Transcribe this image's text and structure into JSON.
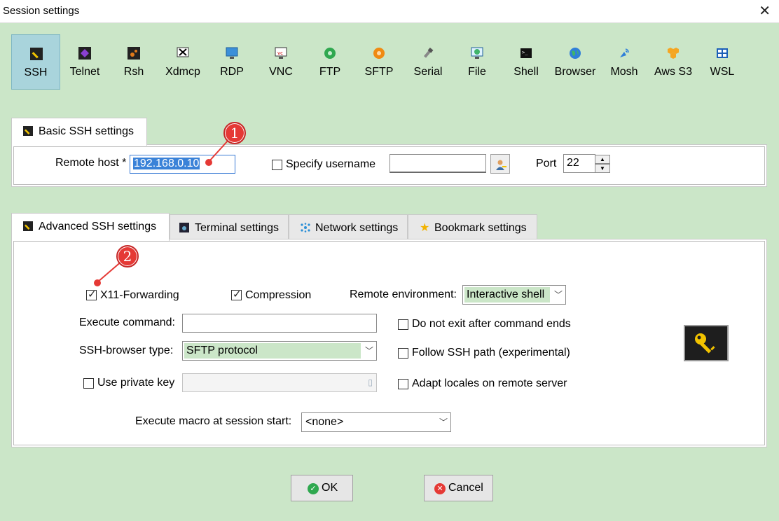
{
  "window": {
    "title": "Session settings"
  },
  "session_types": [
    {
      "label": "SSH",
      "icon": "ssh-icon",
      "selected": true
    },
    {
      "label": "Telnet",
      "icon": "telnet-icon"
    },
    {
      "label": "Rsh",
      "icon": "rsh-icon"
    },
    {
      "label": "Xdmcp",
      "icon": "xdmcp-icon"
    },
    {
      "label": "RDP",
      "icon": "rdp-icon"
    },
    {
      "label": "VNC",
      "icon": "vnc-icon"
    },
    {
      "label": "FTP",
      "icon": "ftp-icon"
    },
    {
      "label": "SFTP",
      "icon": "sftp-icon"
    },
    {
      "label": "Serial",
      "icon": "serial-icon"
    },
    {
      "label": "File",
      "icon": "file-icon"
    },
    {
      "label": "Shell",
      "icon": "shell-icon"
    },
    {
      "label": "Browser",
      "icon": "browser-icon"
    },
    {
      "label": "Mosh",
      "icon": "mosh-icon"
    },
    {
      "label": "Aws S3",
      "icon": "aws-s3-icon"
    },
    {
      "label": "WSL",
      "icon": "wsl-icon"
    }
  ],
  "basic": {
    "tab_label": "Basic SSH settings",
    "remote_host_label": "Remote host *",
    "remote_host_value": "192.168.0.10",
    "specify_username_label": "Specify username",
    "username_value": "",
    "port_label": "Port",
    "port_value": "22"
  },
  "advanced_tabs": [
    {
      "label": "Advanced SSH settings",
      "icon": "ssh-icon",
      "active": true
    },
    {
      "label": "Terminal settings",
      "icon": "terminal-icon"
    },
    {
      "label": "Network settings",
      "icon": "network-icon"
    },
    {
      "label": "Bookmark settings",
      "icon": "star-icon"
    }
  ],
  "advanced": {
    "x11_forwarding_label": "X11-Forwarding",
    "x11_forwarding_checked": true,
    "compression_label": "Compression",
    "compression_checked": true,
    "remote_env_label": "Remote environment:",
    "remote_env_value": "Interactive shell",
    "execute_command_label": "Execute command:",
    "execute_command_value": "",
    "do_not_exit_label": "Do not exit after command ends",
    "ssh_browser_type_label": "SSH-browser type:",
    "ssh_browser_type_value": "SFTP protocol",
    "follow_ssh_path_label": "Follow SSH path (experimental)",
    "use_private_key_label": "Use private key",
    "adapt_locales_label": "Adapt locales on remote server",
    "macro_label": "Execute macro at session start:",
    "macro_value": "<none>"
  },
  "buttons": {
    "ok": "OK",
    "cancel": "Cancel"
  },
  "annotations": {
    "marker1": "1",
    "marker2": "2"
  },
  "colors": {
    "background": "#cbe6c8",
    "selection": "#3a82d8",
    "marker": "#e53935",
    "selected_type": "#a9d4dc"
  }
}
